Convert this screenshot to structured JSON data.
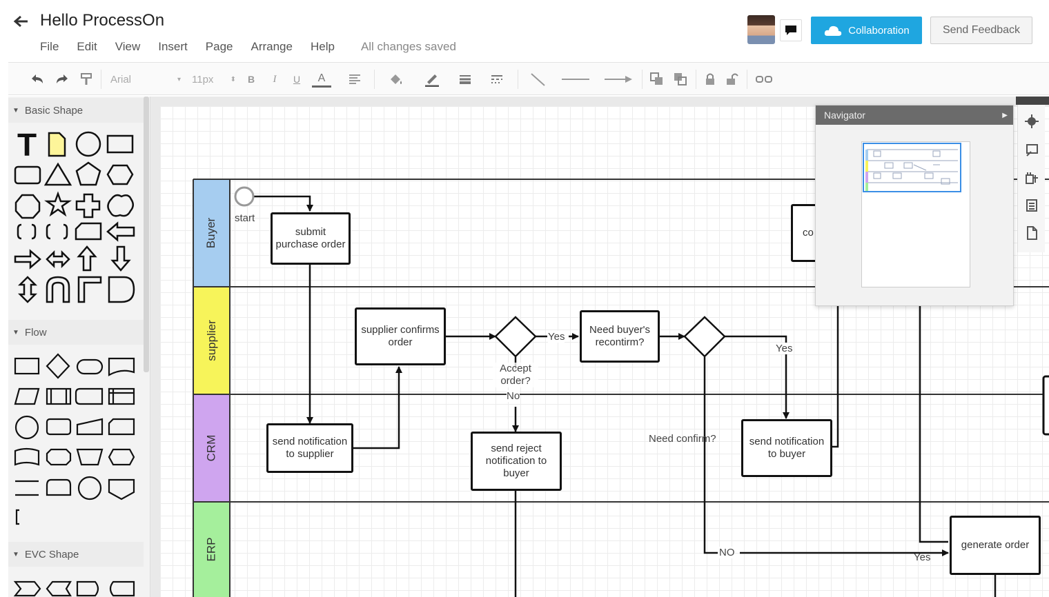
{
  "header": {
    "title": "Hello ProcessOn",
    "menu": [
      "File",
      "Edit",
      "View",
      "Insert",
      "Page",
      "Arrange",
      "Help"
    ],
    "save_status": "All changes saved",
    "collaboration_label": "Collaboration",
    "feedback_label": "Send Feedback",
    "accent_color": "#1fa6e0"
  },
  "toolbar": {
    "font": "Arial",
    "font_size": "11px"
  },
  "sidebar": {
    "sections": [
      "Basic Shape",
      "Flow",
      "EVC Shape"
    ]
  },
  "diagram": {
    "lanes": [
      {
        "label": "Buyer",
        "color": "#a6cdf0"
      },
      {
        "label": "supplier",
        "color": "#f7f45a"
      },
      {
        "label": "CRM",
        "color": "#cfa5ef"
      },
      {
        "label": "ERP",
        "color": "#a5ef9c"
      }
    ],
    "nodes": {
      "start": "start",
      "submit": "submit purchase order",
      "supplier_confirms": "supplier confirms order",
      "need_recontirm": "Need buyer's recontirm?",
      "send_notif_supplier": "send notification to supplier",
      "send_reject": "send reject notification to buyer",
      "send_notif_buyer": "send notification to buyer",
      "generate_order": "generate order",
      "partial_node": "co"
    },
    "labels": {
      "yes1": "Yes",
      "accept": "Accept order?",
      "no1": "No",
      "yes2": "Yes",
      "need_confirm": "Need confirm?",
      "no2": "NO",
      "yes3": "Yes"
    }
  },
  "navigator": {
    "title": "Navigator"
  }
}
